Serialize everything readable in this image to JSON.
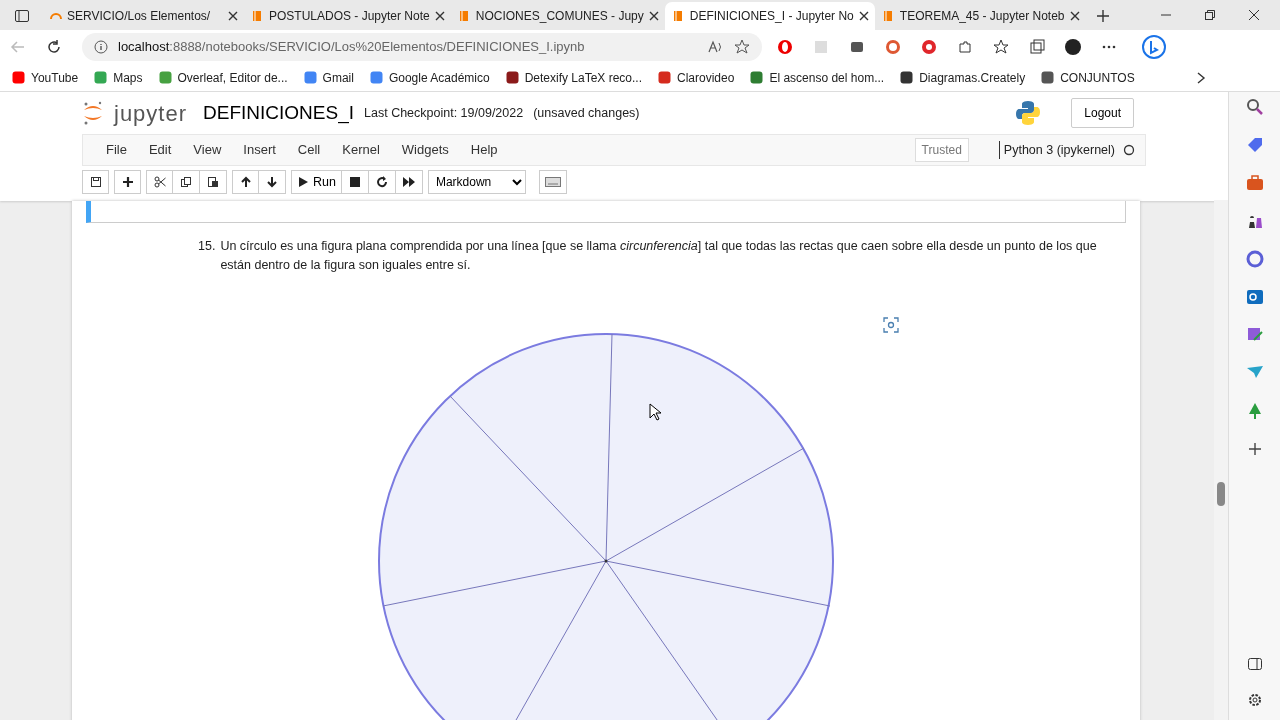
{
  "browser_tabs": [
    {
      "label": "SERVICIO/Los Elementos/",
      "kind": "loading",
      "selected": false
    },
    {
      "label": "POSTULADOS - Jupyter Note",
      "kind": "notebook",
      "selected": false
    },
    {
      "label": "NOCIONES_COMUNES - Jupy",
      "kind": "notebook",
      "selected": false
    },
    {
      "label": "DEFINICIONES_I - Jupyter No",
      "kind": "notebook",
      "selected": true
    },
    {
      "label": "TEOREMA_45 - Jupyter Noteb",
      "kind": "notebook",
      "selected": false
    }
  ],
  "address_bar": {
    "host": "localhost",
    "path": ":8888/notebooks/SERVICIO/Los%20Elementos/DEFINICIONES_I.ipynb"
  },
  "bookmarks": [
    {
      "label": "YouTube",
      "color": "#ff0000"
    },
    {
      "label": "Maps",
      "color": "#34a853"
    },
    {
      "label": "Overleaf, Editor de...",
      "color": "#47a141"
    },
    {
      "label": "Gmail",
      "color": "#4285f4"
    },
    {
      "label": "Google Académico",
      "color": "#4285f4"
    },
    {
      "label": "Detexify LaTeX reco...",
      "color": "#8b1a1a"
    },
    {
      "label": "Clarovideo",
      "color": "#d52b1e"
    },
    {
      "label": "El ascenso del hom...",
      "color": "#2e7d32"
    },
    {
      "label": "Diagramas.Creately",
      "color": "#333333"
    },
    {
      "label": "CONJUNTOS",
      "color": "#555555"
    }
  ],
  "jupyter": {
    "logo_text": "jupyter",
    "notebook_name": "DEFINICIONES_I",
    "checkpoint": "Last Checkpoint: 19/09/2022",
    "save_status": "(unsaved changes)",
    "logout": "Logout",
    "menu": [
      "File",
      "Edit",
      "View",
      "Insert",
      "Cell",
      "Kernel",
      "Widgets",
      "Help"
    ],
    "trusted": "Trusted",
    "kernel": "Python 3 (ipykernel)",
    "toolbar": {
      "run_label": "Run",
      "cell_type": "Markdown"
    }
  },
  "cell": {
    "number": "15.",
    "text": "Un círculo es una figura plana comprendida por una línea [que se llama *circunferencia*] tal que todas las rectas que caen sobre ella desde un punto de los que están dentro de la figura son iguales entre sí."
  }
}
